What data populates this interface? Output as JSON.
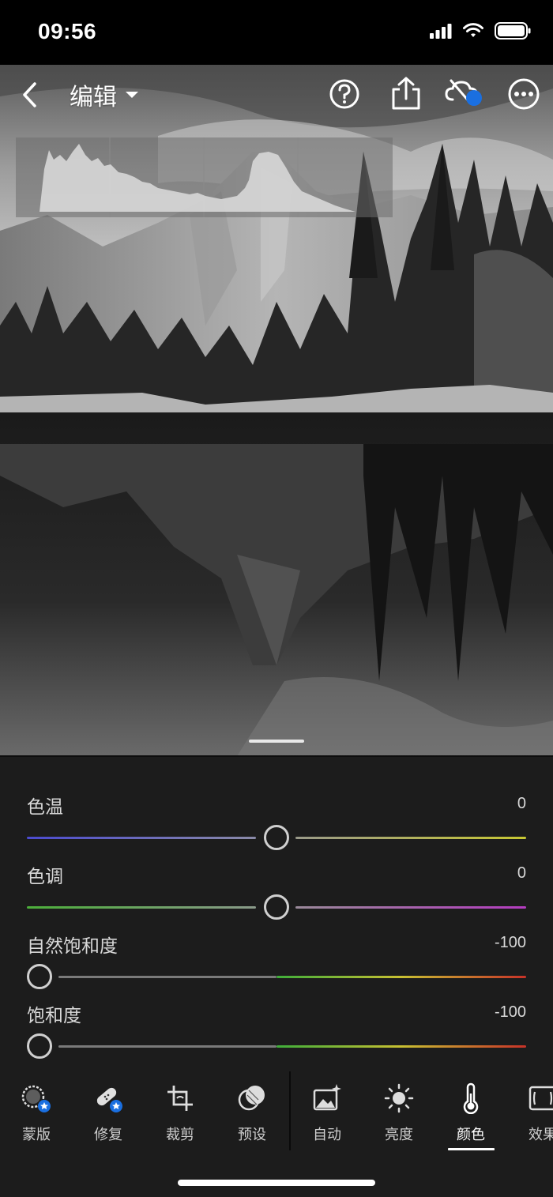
{
  "status_bar": {
    "time": "09:56"
  },
  "header": {
    "title": "编辑"
  },
  "sliders": [
    {
      "label": "色温",
      "value": "0"
    },
    {
      "label": "色调",
      "value": "0"
    },
    {
      "label": "自然饱和度",
      "value": "-100"
    },
    {
      "label": "饱和度",
      "value": "-100"
    }
  ],
  "tools": [
    {
      "label": "蒙版",
      "icon": "mask-icon"
    },
    {
      "label": "修复",
      "icon": "healing-bandage-icon"
    },
    {
      "label": "裁剪",
      "icon": "crop-icon"
    },
    {
      "label": "预设",
      "icon": "presets-icon"
    },
    {
      "label": "自动",
      "icon": "auto-icon"
    },
    {
      "label": "亮度",
      "icon": "sun-icon"
    },
    {
      "label": "颜色",
      "icon": "thermometer-icon",
      "active": true
    },
    {
      "label": "效果",
      "icon": "effects-icon"
    }
  ],
  "colors": {
    "accent_blue": "#1a6fe0",
    "panel_bg": "#1c1c1c",
    "temp_left": "#4b4bd0",
    "temp_right": "#c8c832",
    "tint_left": "#4caf3a",
    "tint_right": "#b43cc0"
  }
}
